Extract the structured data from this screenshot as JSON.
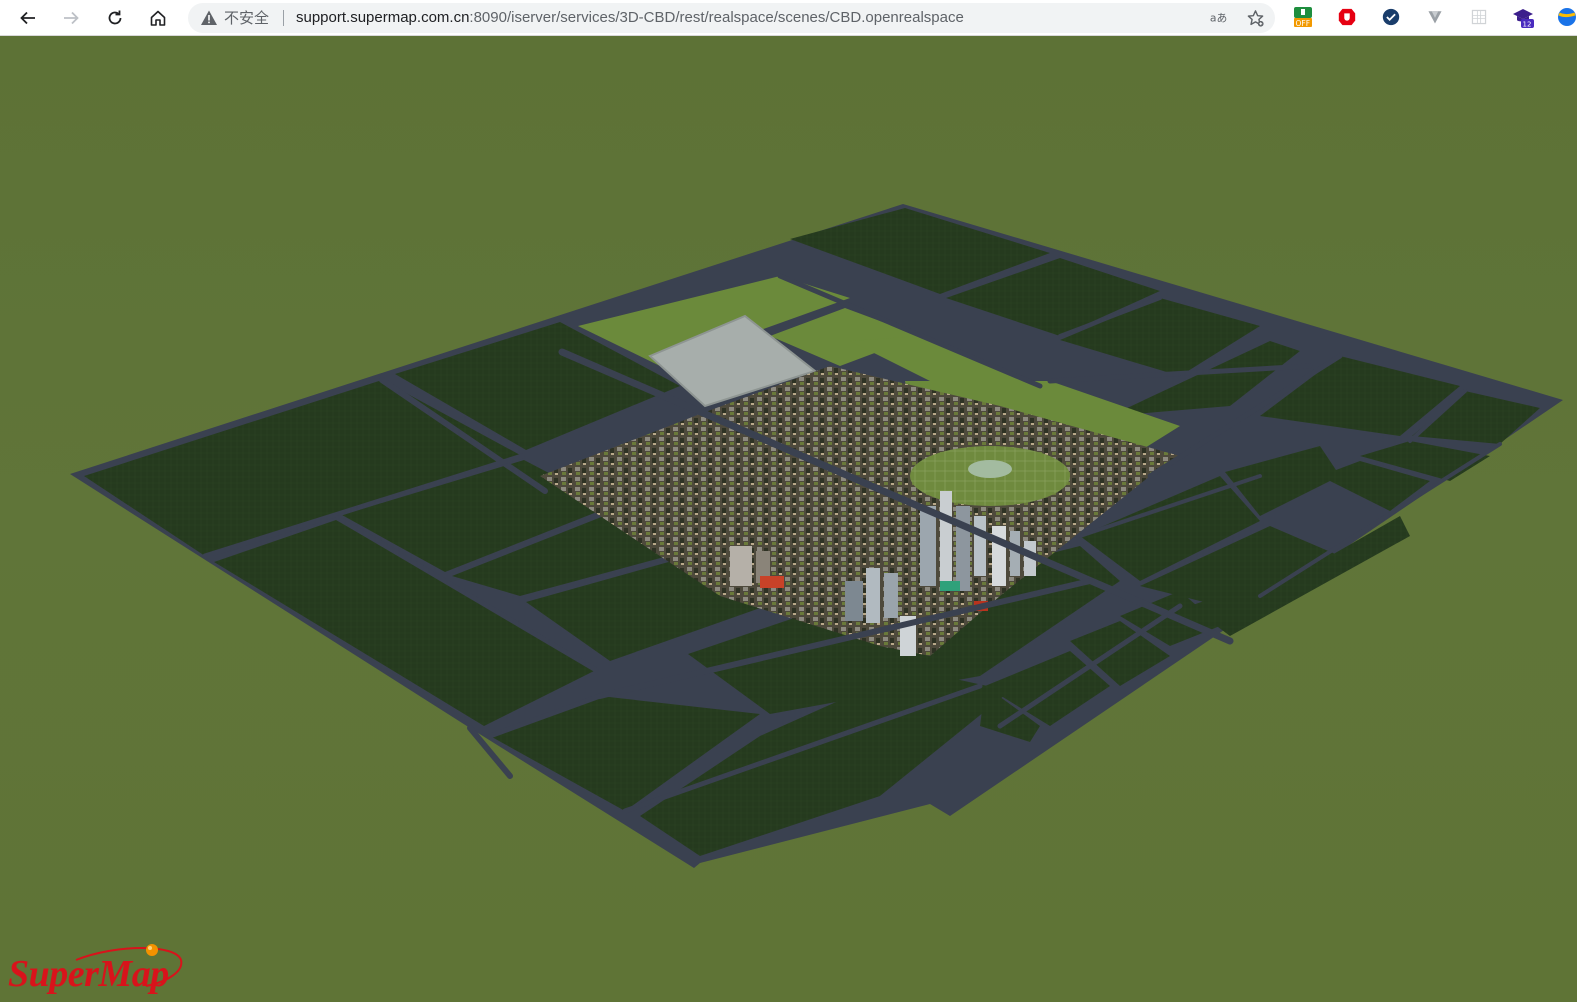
{
  "browser": {
    "security_label": "不安全",
    "url_host": "support.supermap.com.cn",
    "url_path": ":8090/iserver/services/3D-CBD/rest/realspace/scenes/CBD.openrealspace",
    "extensions": [
      {
        "name": "ext-off-icon",
        "badge": "OFF"
      },
      {
        "name": "ext-shield-icon",
        "badge": ""
      },
      {
        "name": "ext-check-icon",
        "badge": ""
      },
      {
        "name": "ext-vuetify-icon",
        "badge": ""
      },
      {
        "name": "ext-grid-icon",
        "badge": ""
      },
      {
        "name": "ext-cap-icon",
        "badge": "12"
      },
      {
        "name": "ext-partial-icon",
        "badge": ""
      }
    ]
  },
  "scene": {
    "logo_text": "SuperMap",
    "colors": {
      "background": "#5e7236",
      "field": "#253a1e",
      "road": "#3a4150",
      "light_green": "#6f8a3e",
      "lot": "#a7aeab",
      "logo": "#d8131b"
    }
  }
}
